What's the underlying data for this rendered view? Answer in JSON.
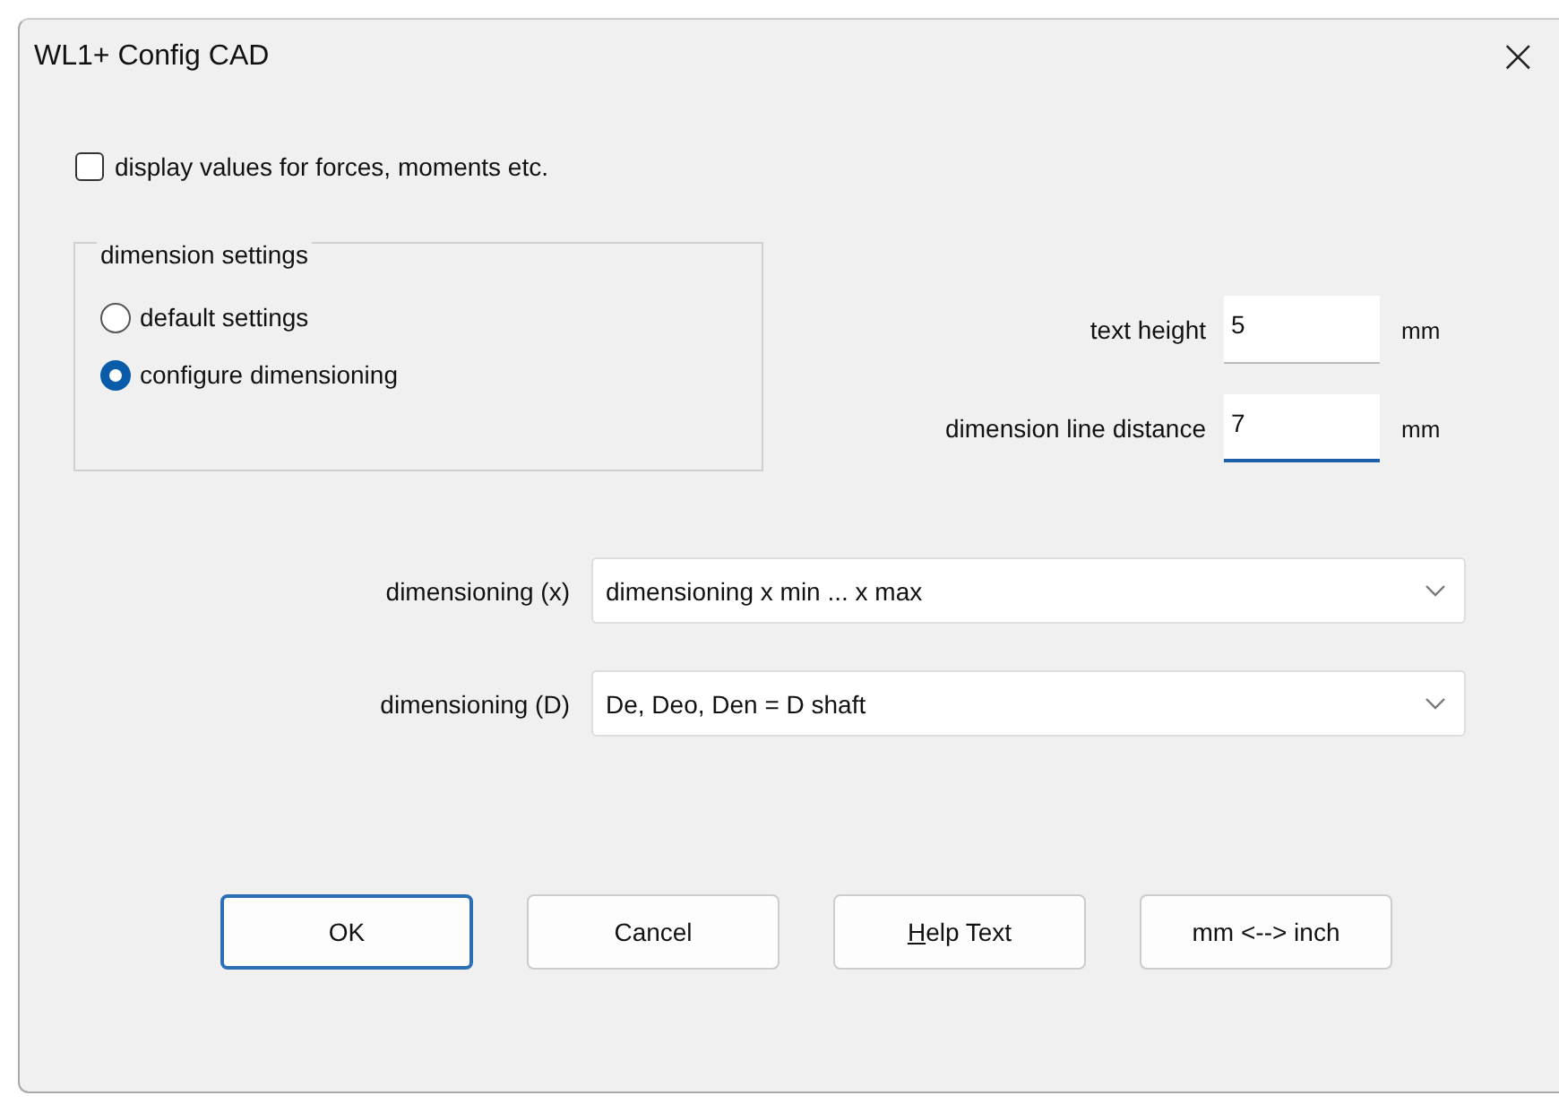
{
  "window": {
    "title": "WL1+ Config CAD",
    "close": "×"
  },
  "display_values": {
    "label": "display values for forces, moments etc.",
    "checked": false
  },
  "dimension_settings": {
    "title": "dimension settings",
    "options": [
      {
        "label": "default settings",
        "selected": false
      },
      {
        "label": "configure dimensioning",
        "selected": true
      }
    ]
  },
  "fields": [
    {
      "label": "text height",
      "value": "5",
      "unit": "mm",
      "focused": false
    },
    {
      "label": "dimension line distance",
      "value": "7",
      "unit": "mm",
      "focused": true
    }
  ],
  "dropdowns": [
    {
      "label": "dimensioning (x)",
      "value": "dimensioning x min ... x max"
    },
    {
      "label": "dimensioning (D)",
      "value": "De, Deo, Den = D shaft"
    }
  ],
  "buttons": [
    {
      "label": "OK",
      "default": true,
      "underline_first": false
    },
    {
      "label": "Cancel",
      "default": false,
      "underline_first": false
    },
    {
      "label": "Help Text",
      "default": false,
      "underline_first": true
    },
    {
      "label": "mm <--> inch",
      "default": false,
      "underline_first": false
    }
  ]
}
